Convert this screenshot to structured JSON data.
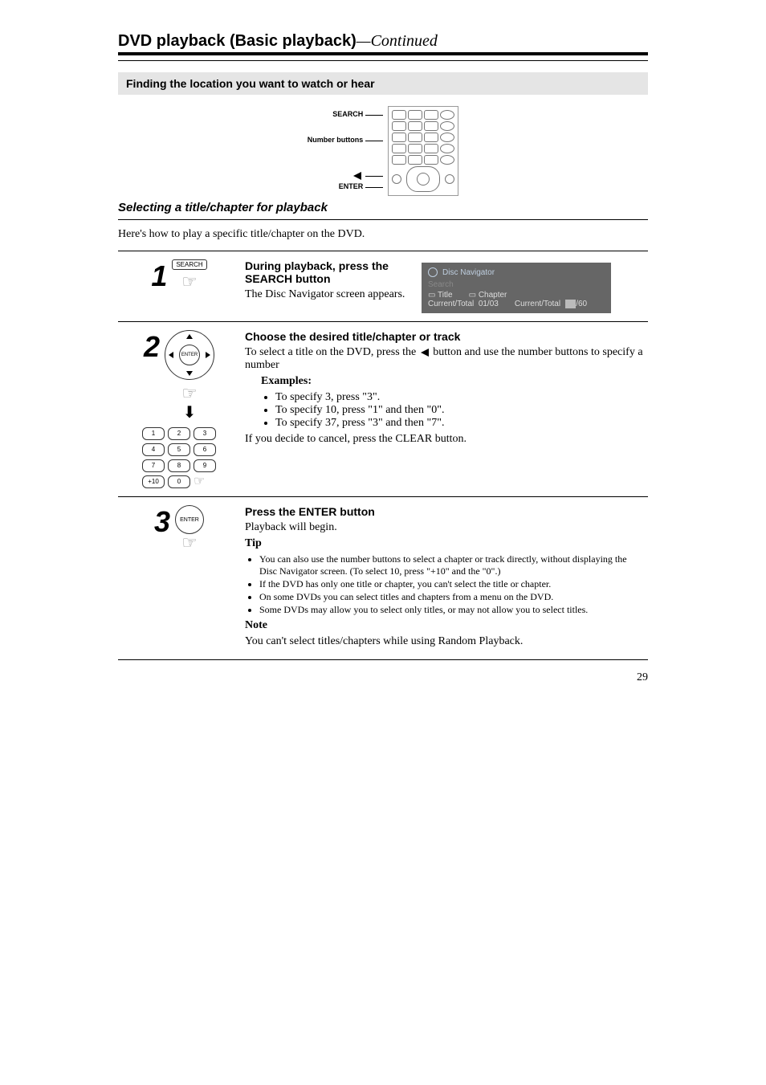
{
  "heading": {
    "main": "DVD playback (Basic playback)",
    "continued": "—Continued"
  },
  "subhead": "Finding the location you want to watch or hear",
  "diagram_labels": {
    "search": "SEARCH",
    "num": "Number buttons",
    "left_arrow_name": "left-arrow-button",
    "enter": "ENTER"
  },
  "subsection_title": "Selecting a title/chapter for playback",
  "intro": "Here's how to play a specific title/chapter on the DVD.",
  "step1": {
    "num": "1",
    "btn_label": "SEARCH",
    "head": "During playback, press the SEARCH button",
    "body": "The Disc Navigator screen appears.",
    "screen": {
      "title": "Disc Navigator",
      "search_word": "Search",
      "title_label": "Title",
      "chapter_label": "Chapter",
      "ct_label_a": "Current/Total",
      "title_val": "01/03",
      "ct_label_b": "Current/Total",
      "chap_val_suffix": "/60"
    }
  },
  "step2": {
    "num": "2",
    "head": "Choose the desired title/chapter or track",
    "line1a": "To select a title on the DVD, press the ",
    "line1b": " button and use the number buttons to specify a number",
    "examples_head": "Examples:",
    "ex1": "To specify 3, press \"3\".",
    "ex2": "To specify 10, press \"1\" and then \"0\".",
    "ex3": "To specify 37, press \"3\" and then \"7\".",
    "cancel": "If you decide to cancel, press the CLEAR button.",
    "numpad": [
      "1",
      "2",
      "3",
      "4",
      "5",
      "6",
      "7",
      "8",
      "9",
      "+10",
      "0"
    ]
  },
  "step3": {
    "num": "3",
    "enter_label": "ENTER",
    "head": "Press the ENTER button",
    "line1": "Playback will begin.",
    "tip_head": "Tip",
    "tips": [
      "You can also use the number buttons to select a chapter or track directly, without displaying the Disc Navigator screen. (To select 10, press \"+10\" and the \"0\".)",
      "If the DVD has only one title or chapter, you can't select the title or chapter.",
      "On some DVDs you can select titles and chapters from a menu on the DVD.",
      "Some DVDs may allow you to select only titles, or may not allow you to select titles."
    ],
    "note_head": "Note",
    "note": "You can't select titles/chapters while using Random Playback."
  },
  "page_no": "29"
}
